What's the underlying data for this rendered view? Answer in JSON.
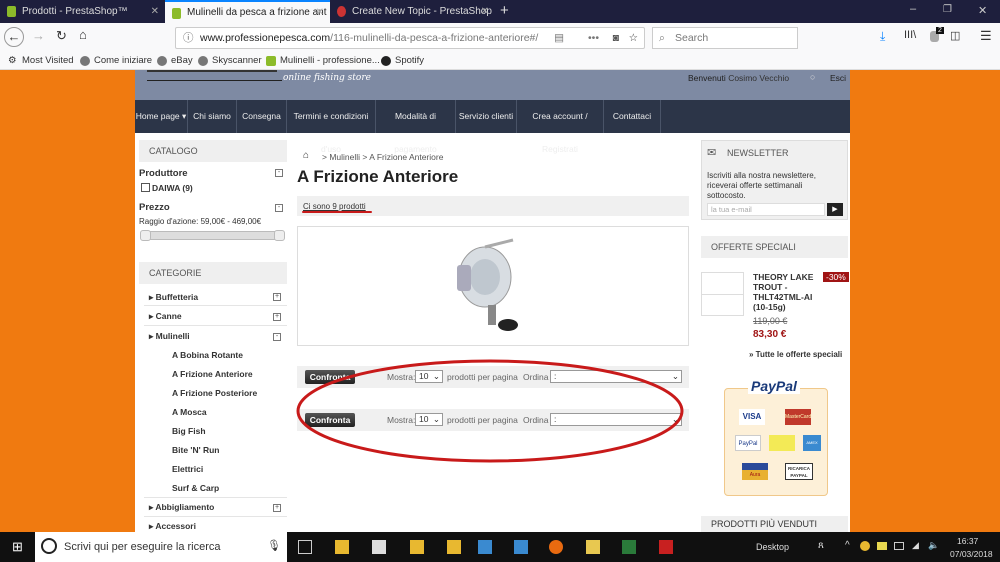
{
  "browser": {
    "tabs": [
      {
        "title": "Prodotti - PrestaShop™"
      },
      {
        "title": "Mulinelli da pesca a frizione ant"
      },
      {
        "title": "Create New Topic - PrestaShop"
      }
    ],
    "url_domain": "www.professionepesca.com",
    "url_path": "/116-mulinelli-da-pesca-a-frizione-anteriore#/",
    "search_placeholder": "Search",
    "badge": "2",
    "bookmarks": [
      "Most Visited",
      "Come iniziare",
      "eBay",
      "Skyscanner",
      "Mulinelli - professione...",
      "Spotify"
    ]
  },
  "header": {
    "tagline": "online fishing store",
    "welcome": "Benvenuti",
    "user": "Cosimo Vecchio",
    "logout": "Esci"
  },
  "nav": [
    "Home page",
    "Chi siamo",
    "Consegna",
    "Termini e condizioni d'uso",
    "Modalità di pagamento",
    "Servizio clienti",
    "Crea account / Registrati",
    "Contattaci"
  ],
  "catalog": {
    "title": "CATALOGO",
    "producer_label": "Produttore",
    "producer_option": "DAIWA (9)",
    "price_label": "Prezzo",
    "price_range": "Raggio d'azione: 59,00€ - 469,00€"
  },
  "categories": {
    "title": "CATEGORIE",
    "top": [
      "Buffetteria",
      "Canne",
      "Mulinelli"
    ],
    "sub": [
      "A Bobina Rotante",
      "A Frizione Anteriore",
      "A Frizione Posteriore",
      "A Mosca",
      "Big Fish",
      "Bite 'N' Run",
      "Elettrici",
      "Surf & Carp"
    ],
    "bottom": [
      "Abbigliamento",
      "Accessori"
    ]
  },
  "main": {
    "breadcrumb": [
      "Mulinelli",
      "A Frizione Anteriore"
    ],
    "title": "A Frizione Anteriore",
    "count": "Ci sono 9 prodotti",
    "toolbar": {
      "compare": "Confronta",
      "show_label": "Mostra:",
      "per_page": "10",
      "per_page_suffix": "prodotti per pagina",
      "sort_label": "Ordina",
      "sort_value": ":"
    }
  },
  "newsletter": {
    "title": "NEWSLETTER",
    "text": "Iscriviti alla nostra newslettere, riceverai offerte settimanali sottocosto.",
    "placeholder": "la tua e-mail"
  },
  "specials": {
    "title": "OFFERTE SPECIALI",
    "product": "THEORY LAKE TROUT - THLT42TML-AI (10-15g)",
    "discount": "-30%",
    "old_price": "119,00 €",
    "price": "83,30 €",
    "all_link": "» Tutte le offerte speciali"
  },
  "paypal": {
    "logo": "PayPal",
    "cards": [
      "VISA",
      "MasterCard",
      "PayPal",
      "",
      "AMEX",
      "Aura",
      "RICARICA PAYPAL"
    ]
  },
  "bestsellers": {
    "title": "PRODOTTI PIÙ VENDUTI"
  },
  "taskbar": {
    "search": "Scrivi qui per eseguire la ricerca",
    "desktop": "Desktop",
    "time": "16:37",
    "date": "07/03/2018"
  }
}
